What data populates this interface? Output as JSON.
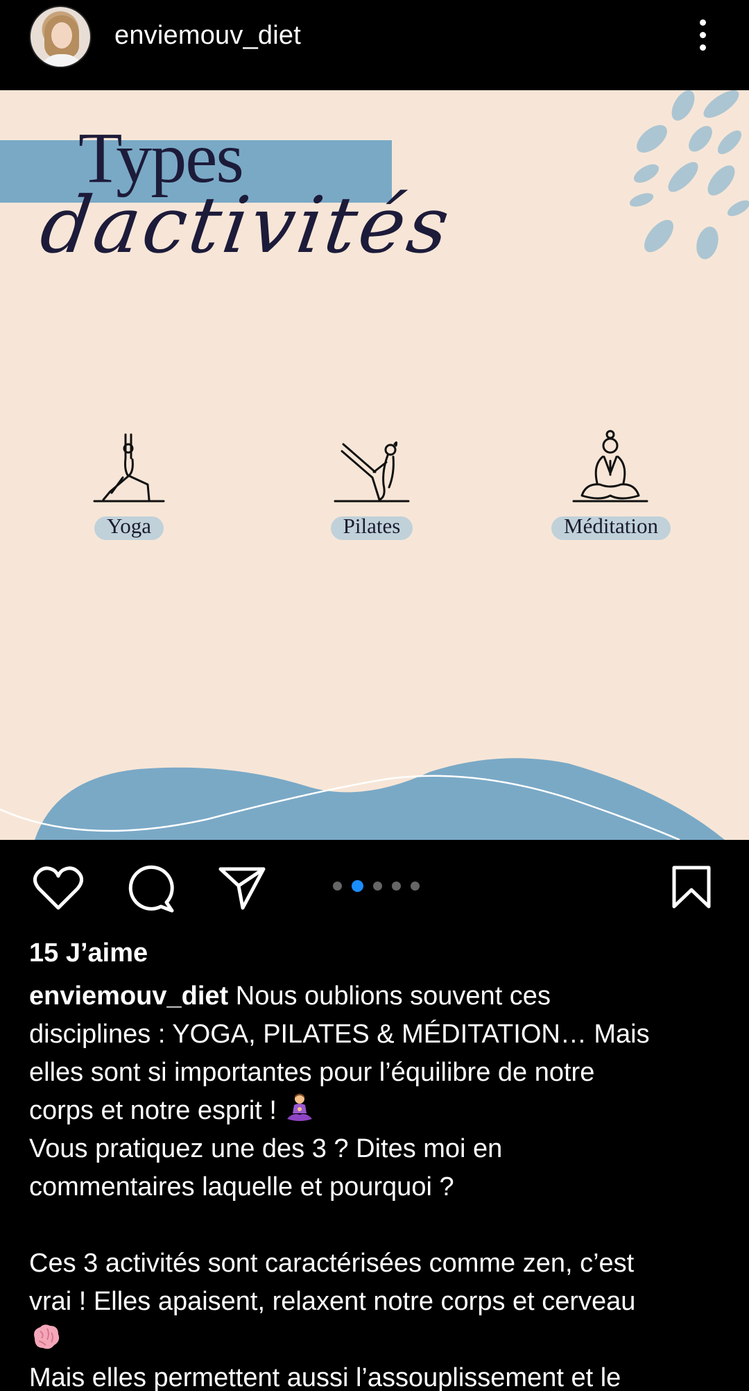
{
  "header": {
    "username": "enviemouv_diet",
    "avatar_icon": "profile-photo",
    "more_icon": "vertical-ellipsis-icon"
  },
  "post_image": {
    "title_line1": "Types",
    "title_line2": "dactivités",
    "activities": [
      {
        "label": "Yoga",
        "icon": "yoga-pose-icon"
      },
      {
        "label": "Pilates",
        "icon": "pilates-pose-icon"
      },
      {
        "label": "Méditation",
        "icon": "meditation-pose-icon"
      }
    ],
    "colors": {
      "background": "#f7e6d7",
      "accent_blue": "#7aa9c6",
      "title_ink": "#1d1b3a",
      "carousel_active_dot": "#1a8dff"
    }
  },
  "carousel": {
    "total": 5,
    "active": 2
  },
  "actions": {
    "like_icon": "heart-icon",
    "comment_icon": "comment-bubble-icon",
    "share_icon": "paper-plane-icon",
    "save_icon": "bookmark-icon"
  },
  "likes_text": "15 J’aime",
  "caption": {
    "username": "enviemouv_diet",
    "line1": "Nous oublions souvent ces",
    "line2": "disciplines : YOGA, PILATES & MÉDITATION… Mais",
    "line3": "elles sont si importantes pour l’équilibre de notre",
    "line4": "corps et notre esprit ! ",
    "line5": "Vous pratiquez une des 3 ? Dites moi en",
    "line6": "commentaires laquelle et pourquoi ?",
    "line7": "Ces 3 activités sont caractérisées comme zen, c’est",
    "line8": "vrai ! Elles apaisent, relaxent notre corps et cerveau",
    "line10": "Mais elles permettent aussi l’assouplissement et le",
    "emoji1": "woman-in-lotus-position-emoji",
    "emoji2": "brain-emoji"
  }
}
